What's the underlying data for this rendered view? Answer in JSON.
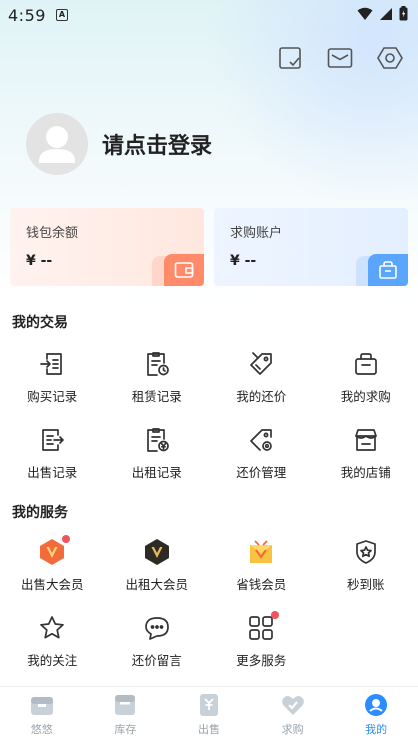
{
  "status_bar": {
    "time": "4:59",
    "app_badge": "A"
  },
  "profile": {
    "login_prompt": "请点击登录"
  },
  "cards": [
    {
      "title": "钱包余额",
      "amount": "¥ --",
      "icon": "wallet-icon"
    },
    {
      "title": "求购账户",
      "amount": "¥ --",
      "icon": "shopping-bag-icon"
    }
  ],
  "transactions": {
    "title": "我的交易",
    "items": [
      {
        "label": "购买记录",
        "icon": "purchase-record-icon"
      },
      {
        "label": "租赁记录",
        "icon": "rental-record-icon"
      },
      {
        "label": "我的还价",
        "icon": "price-tag-icon"
      },
      {
        "label": "我的求购",
        "icon": "request-bag-icon"
      },
      {
        "label": "出售记录",
        "icon": "sale-record-icon"
      },
      {
        "label": "出租记录",
        "icon": "rent-out-record-icon"
      },
      {
        "label": "还价管理",
        "icon": "tag-settings-icon"
      },
      {
        "label": "我的店铺",
        "icon": "store-icon"
      }
    ]
  },
  "services": {
    "title": "我的服务",
    "items": [
      {
        "label": "出售大会员",
        "icon": "seller-vip-icon",
        "badge": true
      },
      {
        "label": "出租大会员",
        "icon": "rental-vip-icon",
        "badge": false
      },
      {
        "label": "省钱会员",
        "icon": "saver-vip-icon",
        "badge": false
      },
      {
        "label": "秒到账",
        "icon": "instant-shield-icon",
        "badge": false
      },
      {
        "label": "我的关注",
        "icon": "star-icon",
        "badge": false
      },
      {
        "label": "还价留言",
        "icon": "chat-bubble-icon",
        "badge": false
      },
      {
        "label": "更多服务",
        "icon": "grid-more-icon",
        "badge": true
      }
    ]
  },
  "nav": [
    {
      "label": "悠悠",
      "icon": "home-box-icon",
      "active": false
    },
    {
      "label": "库存",
      "icon": "inventory-icon",
      "active": false
    },
    {
      "label": "出售",
      "icon": "sell-icon",
      "active": false
    },
    {
      "label": "求购",
      "icon": "buy-heart-icon",
      "active": false
    },
    {
      "label": "我的",
      "icon": "profile-icon",
      "active": true
    }
  ],
  "colors": {
    "accent": "#2b8cff",
    "badge": "#f2545b",
    "wallet_icon": "#ff8b6b",
    "purchase_icon": "#5aa6ff"
  }
}
